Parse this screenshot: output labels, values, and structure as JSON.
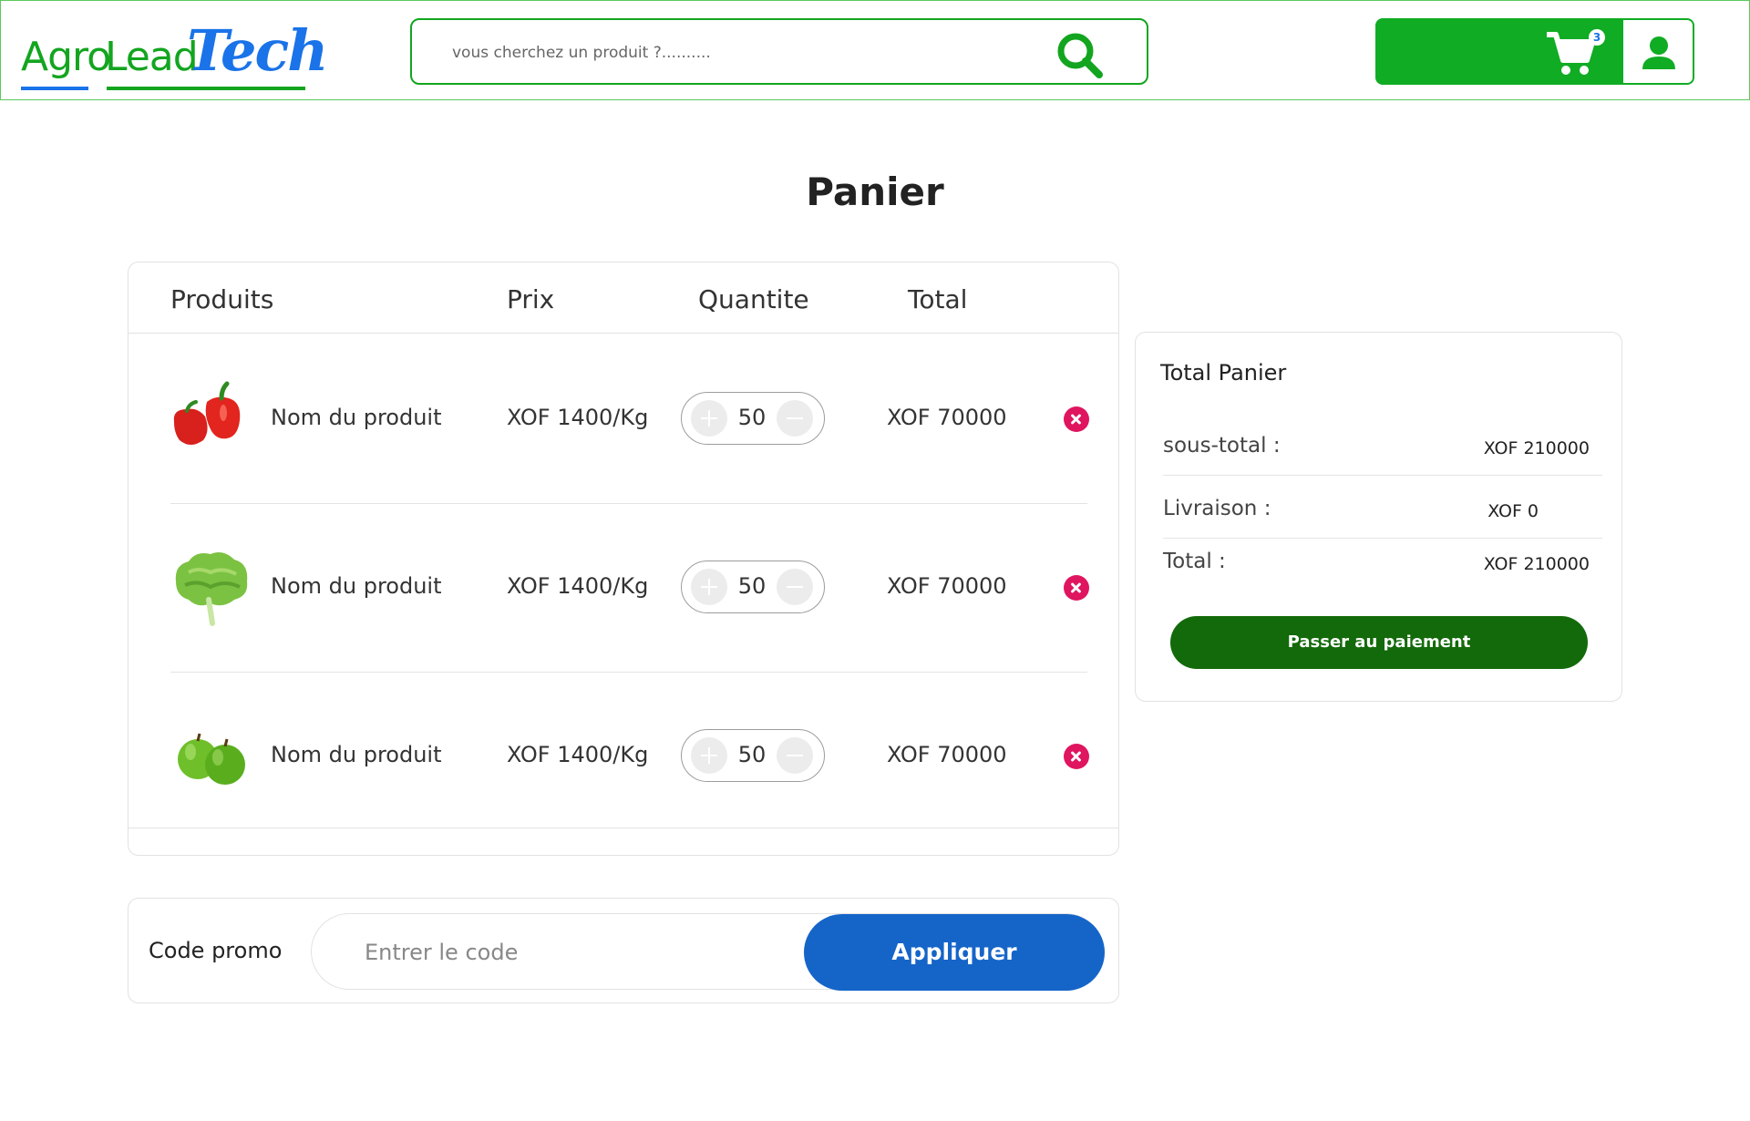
{
  "header": {
    "logo": {
      "agro": "Agro",
      "lead": "Lead",
      "tech": "Tech"
    },
    "search_placeholder": "vous cherchez un produit ?..........",
    "cart_count": "3",
    "colors": {
      "brand_green": "#10ac24",
      "brand_blue": "#1a73e8"
    }
  },
  "page_title": "Panier",
  "table": {
    "headers": {
      "produits": "Produits",
      "prix": "Prix",
      "quantite": "Quantite",
      "total": "Total"
    },
    "rows": [
      {
        "name": "Nom du produit",
        "price": "XOF 1400/Kg",
        "qty": "50",
        "total": "XOF 70000",
        "image": "red-pepper"
      },
      {
        "name": "Nom du produit",
        "price": "XOF 1400/Kg",
        "qty": "50",
        "total": "XOF 70000",
        "image": "lettuce"
      },
      {
        "name": "Nom du produit",
        "price": "XOF 1400/Kg",
        "qty": "50",
        "total": "XOF 70000",
        "image": "green-apples"
      }
    ]
  },
  "promo": {
    "label": "Code promo",
    "placeholder": "Entrer le code",
    "apply_label": "Appliquer"
  },
  "summary": {
    "title": "Total Panier",
    "subtotal_label": "sous-total :",
    "subtotal_value": "XOF 210000",
    "delivery_label": "Livraison :",
    "delivery_value": "XOF 0",
    "total_label": "Total :",
    "total_value": "XOF 210000",
    "checkout_label": "Passer au paiement"
  }
}
